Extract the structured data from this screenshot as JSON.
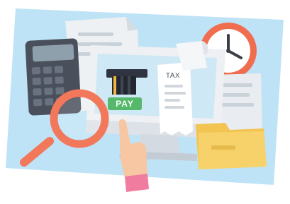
{
  "illustration": {
    "receipt_heading": "TAX",
    "pay_button_label": "PAY"
  },
  "colors": {
    "background_card": "#bfe3f6",
    "monitor_frame": "#eef0f3",
    "monitor_screen": "#cfe8f5",
    "pay_button": "#55b86a",
    "clock_rim": "#f06d4f",
    "magnifier": "#f2785c",
    "folder": "#f7d26b",
    "calculator": "#4a4f5c",
    "hand_skin": "#f7c6a3",
    "sleeve": "#f07da0"
  },
  "icons": [
    "wall-clock-icon",
    "calculator-icon",
    "magnifying-glass-icon",
    "folder-icon",
    "tax-receipt-icon",
    "card-terminal-icon",
    "pointing-hand-icon"
  ]
}
